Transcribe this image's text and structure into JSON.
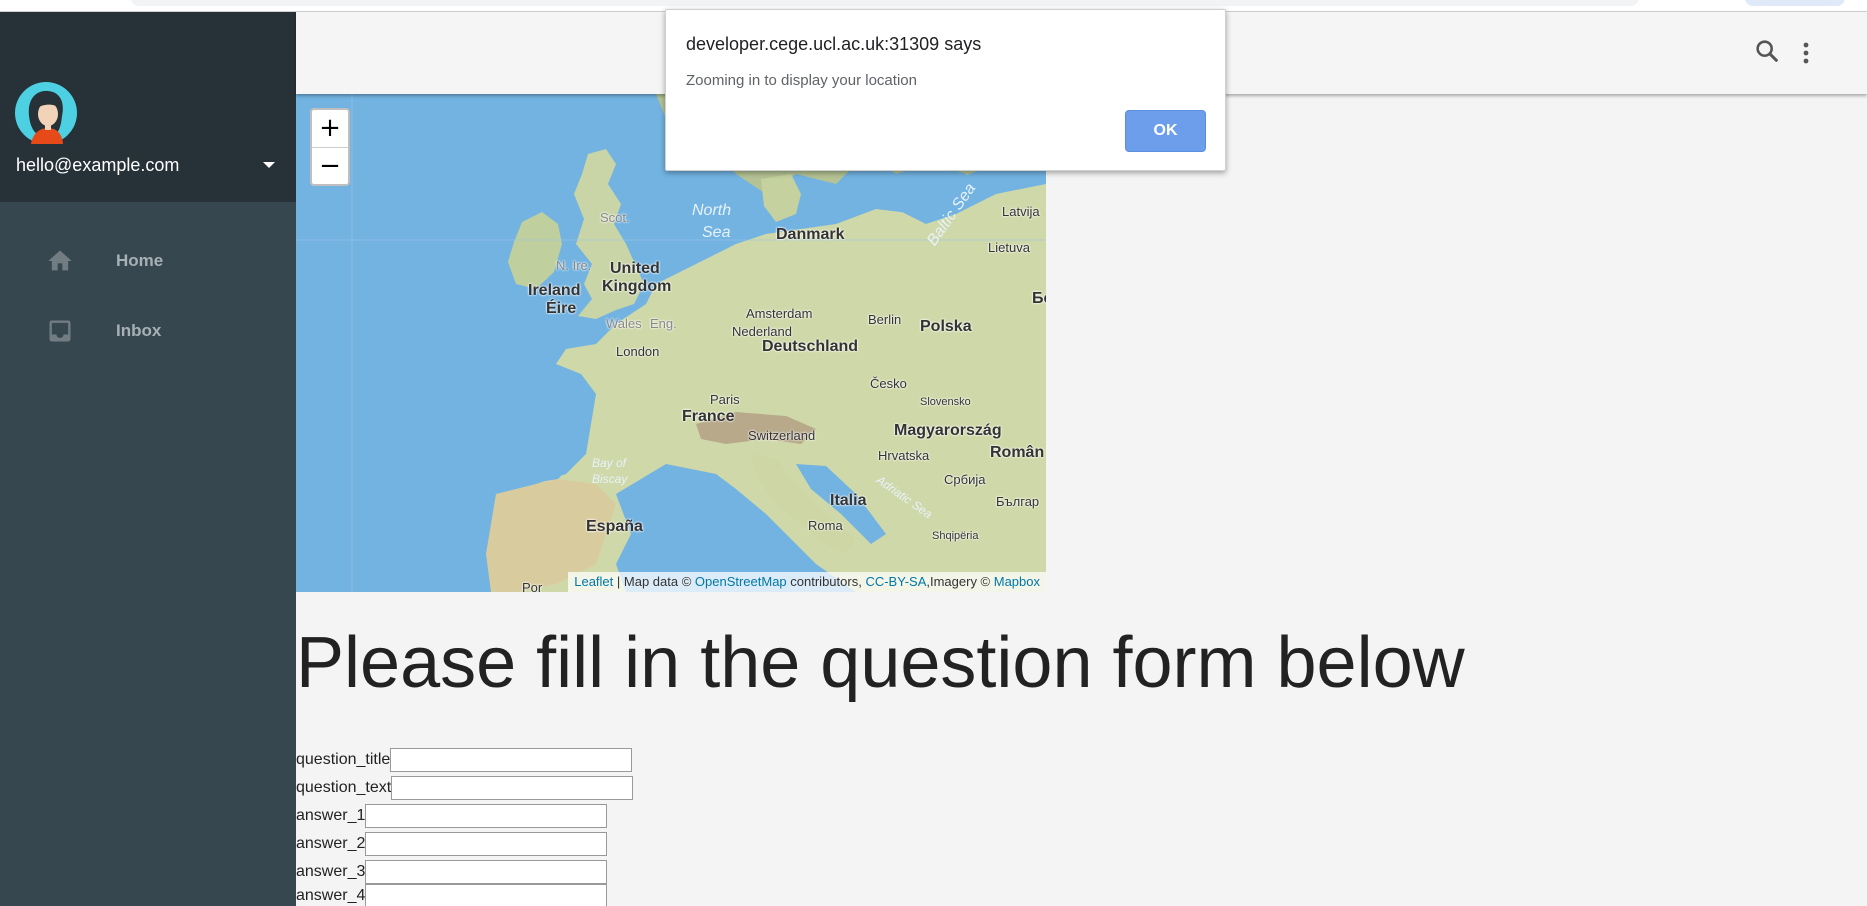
{
  "alert": {
    "title": "developer.cege.ucl.ac.uk:31309 says",
    "message": "Zooming in to display your location",
    "ok_label": "OK"
  },
  "account": {
    "email": "hello@example.com"
  },
  "sidebar": {
    "items": [
      {
        "label": "Home",
        "icon": "home-icon"
      },
      {
        "label": "Inbox",
        "icon": "inbox-icon"
      }
    ]
  },
  "header": {
    "icons": [
      "search-icon",
      "more-vert-icon"
    ]
  },
  "map": {
    "zoom_in": "+",
    "zoom_out": "−",
    "attribution": {
      "leaflet": "Leaflet",
      "sep1": " | Map data © ",
      "osm": "OpenStreetMap",
      "mid": " contributors, ",
      "license": "CC-BY-SA",
      "imagery": ",Imagery © ",
      "mapbox": "Mapbox"
    },
    "labels": {
      "north_sea": "North",
      "north_sea2": "Sea",
      "danmark": "Danmark",
      "baltic": "Baltic Sea",
      "latvija": "Latvija",
      "lietuva": "Lietuva",
      "scot": "Scot.",
      "n_ire": "N. Ire.",
      "united": "United",
      "kingdom": "Kingdom",
      "ireland": "Ireland",
      "eire": "Éire",
      "wales": "Wales",
      "eng": "Eng.",
      "london": "London",
      "amsterdam": "Amsterdam",
      "nederland": "Nederland",
      "berlin": "Berlin",
      "polska": "Polska",
      "deutschland": "Deutschland",
      "be": "Бе",
      "cesko": "Česko",
      "paris": "Paris",
      "slovensko": "Slovensko",
      "france": "France",
      "switzerland": "Switzerland",
      "magyarorszag": "Magyarország",
      "bay_of": "Bay of",
      "biscay": "Biscay",
      "hrvatska": "Hrvatska",
      "roman": "Român",
      "srbija": "Србија",
      "italia": "Italia",
      "adriatic": "Adriatic Sea",
      "balgar": "Българ",
      "espana": "España",
      "roma": "Roma",
      "shqiperia": "Shqipëria",
      "por": "Por"
    }
  },
  "main": {
    "title": "Please fill in the question form below",
    "fields": [
      {
        "label": "question_title",
        "value": ""
      },
      {
        "label": "question_text",
        "value": ""
      },
      {
        "label": "answer_1",
        "value": ""
      },
      {
        "label": "answer_2",
        "value": ""
      },
      {
        "label": "answer_3",
        "value": ""
      },
      {
        "label": "answer_4",
        "value": ""
      }
    ]
  },
  "colors": {
    "drawer_bg": "#37474f",
    "drawer_header_bg": "#263238",
    "ok_button": "#6d9eeb",
    "sea": "#72b3e2"
  }
}
